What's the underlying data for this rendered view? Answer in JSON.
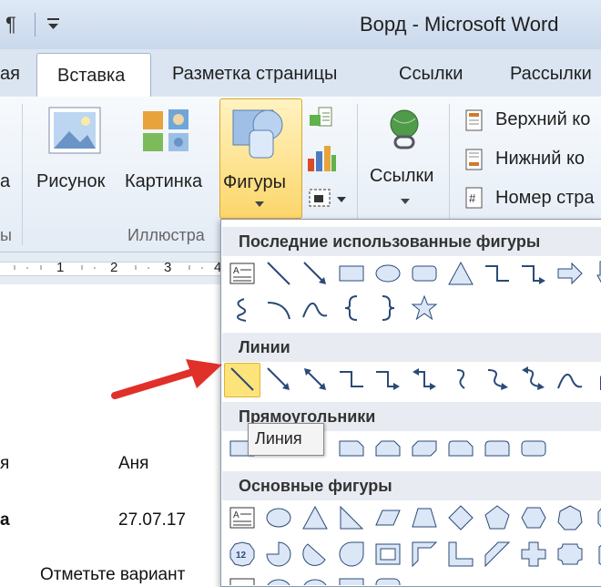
{
  "titlebar": {
    "pilcrow": "¶",
    "title": "Ворд  -  Microsoft Word"
  },
  "tabs": {
    "left_partial": "ая",
    "insert": "Вставка",
    "layout": "Разметка страницы",
    "links": "Ссылки",
    "mailings": "Рассылки"
  },
  "ribbon": {
    "left_partial": "а",
    "picture": "Рисунок",
    "clipart": "Картинка",
    "shapes": "Фигуры",
    "hyperlinks": "Ссылки",
    "header": "Верхний ко",
    "footer": "Нижний ко",
    "page_number": "Номер стра",
    "group_left_partial": "ы",
    "group_illustrations": "Иллюстра"
  },
  "ruler": {
    "marks": [
      "1",
      "2",
      "3",
      "4"
    ]
  },
  "document": {
    "row1_left": "я",
    "row1_name": "Аня",
    "row2_left": "а",
    "row2_date": "27.07.17",
    "bottom_text": "Отметьте вариант"
  },
  "menu": {
    "recent_title": "Последние использованные фигуры",
    "lines_title": "Линии",
    "rectangles_title": "Прямоугольники",
    "basic_title": "Основные фигуры",
    "tooltip": "Линия"
  },
  "colors": {
    "accent_highlight": "#fce37a",
    "arrow": "#e0302a",
    "shape_fill": "#dbe7f6",
    "shape_stroke": "#2b4a78"
  }
}
